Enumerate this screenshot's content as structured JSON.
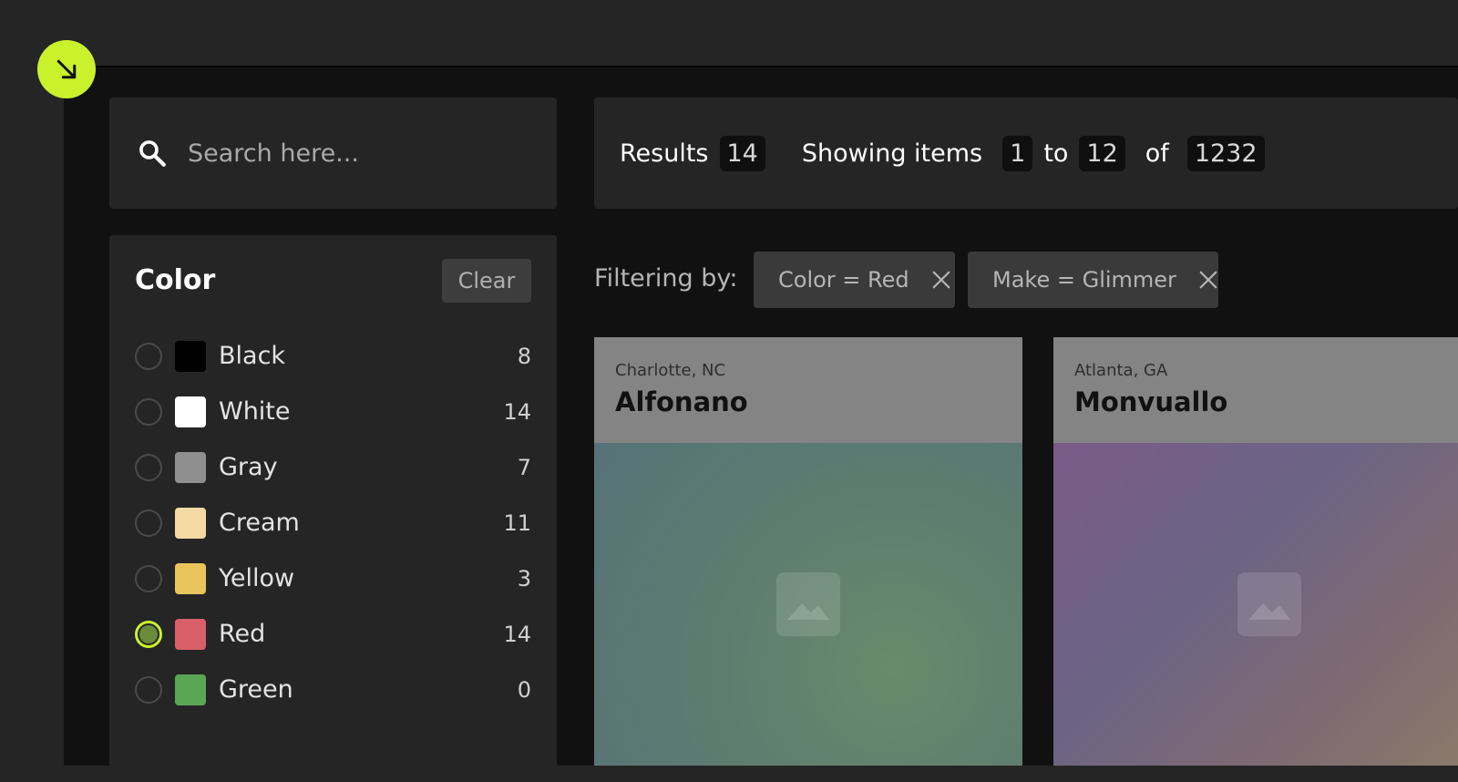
{
  "search": {
    "placeholder": "Search here..."
  },
  "results": {
    "results_label": "Results",
    "results_count": "14",
    "showing_label": "Showing items",
    "from": "1",
    "to_label": "to",
    "to": "12",
    "of_label": "of",
    "total": "1232"
  },
  "filter": {
    "title": "Color",
    "clear_label": "Clear",
    "colors": [
      {
        "name": "Black",
        "count": "8",
        "swatch": "#000000",
        "selected": false
      },
      {
        "name": "White",
        "count": "14",
        "swatch": "#ffffff",
        "selected": false
      },
      {
        "name": "Gray",
        "count": "7",
        "swatch": "#8f8f8f",
        "selected": false
      },
      {
        "name": "Cream",
        "count": "11",
        "swatch": "#f4d9a3",
        "selected": false
      },
      {
        "name": "Yellow",
        "count": "3",
        "swatch": "#e8c45a",
        "selected": false
      },
      {
        "name": "Red",
        "count": "14",
        "swatch": "#d85f68",
        "selected": true
      },
      {
        "name": "Green",
        "count": "0",
        "swatch": "#5aa655",
        "selected": false
      }
    ]
  },
  "active_filters": {
    "label": "Filtering by:",
    "chips": [
      {
        "label": "Color = Red"
      },
      {
        "label": "Make = Glimmer"
      }
    ]
  },
  "cards": [
    {
      "location": "Charlotte, NC",
      "name": "Alfonano"
    },
    {
      "location": "Atlanta, GA",
      "name": "Monvuallo"
    }
  ],
  "colors": {
    "accent": "#c9f22c",
    "panel": "#252525",
    "frame": "#111111"
  }
}
